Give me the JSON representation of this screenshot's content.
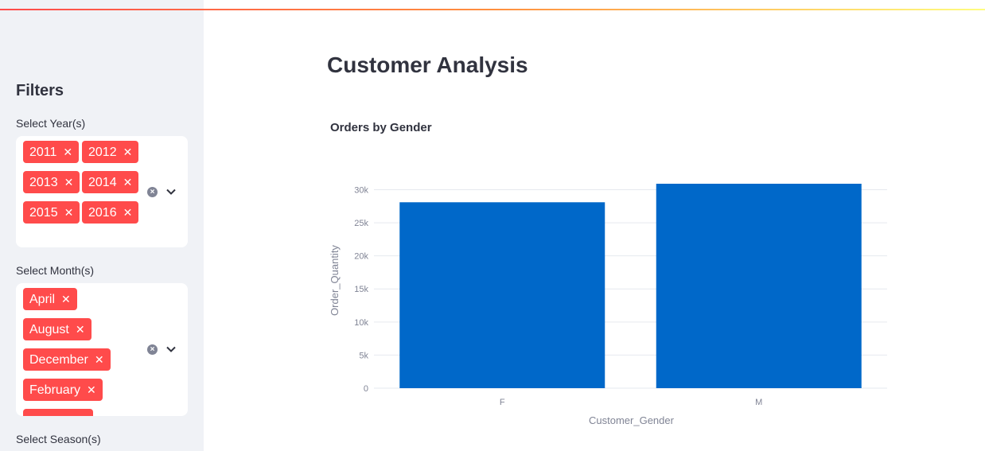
{
  "sidebar": {
    "header": "Filters",
    "year_filter": {
      "label": "Select Year(s)",
      "tags": [
        "2011",
        "2012",
        "2013",
        "2014",
        "2015",
        "2016"
      ]
    },
    "month_filter": {
      "label": "Select Month(s)",
      "tags": [
        "April",
        "August",
        "December",
        "February",
        ""
      ]
    },
    "season_filter": {
      "label": "Select Season(s)"
    },
    "tag_remove_glyph": "✕",
    "clear_glyph": "×"
  },
  "main": {
    "title": "Customer Analysis"
  },
  "colors": {
    "accent": "#ff4b4b",
    "bar": "#0068c9",
    "sidebar_bg": "#f0f2f6"
  },
  "chart_data": {
    "type": "bar",
    "title": "Orders by Gender",
    "categories": [
      "F",
      "M"
    ],
    "values": [
      28100,
      30900
    ],
    "xlabel": "Customer_Gender",
    "ylabel": "Order_Quantity",
    "ylim": [
      0,
      30900
    ],
    "yticks": [
      0,
      5000,
      10000,
      15000,
      20000,
      25000,
      30000
    ],
    "ytick_labels": [
      "0",
      "5k",
      "10k",
      "15k",
      "20k",
      "25k",
      "30k"
    ],
    "grid": true
  }
}
